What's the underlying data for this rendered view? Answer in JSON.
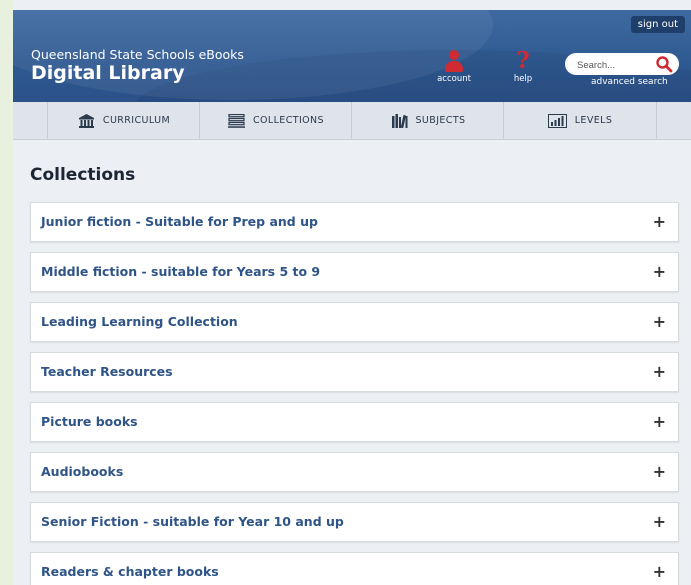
{
  "header": {
    "sign_out": "sign out",
    "subtitle": "Queensland State Schools eBooks",
    "title": "Digital Library",
    "account_label": "account",
    "help_label": "help",
    "search_placeholder": "Search...",
    "advanced_search": "advanced search",
    "accent_color": "#cf2b33"
  },
  "nav": {
    "items": [
      {
        "label": "CURRICULUM",
        "icon": "building-icon"
      },
      {
        "label": "COLLECTIONS",
        "icon": "list-icon"
      },
      {
        "label": "SUBJECTS",
        "icon": "books-icon"
      },
      {
        "label": "LEVELS",
        "icon": "bar-chart-icon"
      }
    ]
  },
  "main": {
    "heading": "Collections",
    "collections": [
      {
        "label": "Junior fiction - Suitable for Prep and up",
        "toggle": "+"
      },
      {
        "label": "Middle fiction - suitable for Years 5 to 9",
        "toggle": "+"
      },
      {
        "label": "Leading Learning Collection",
        "toggle": "+"
      },
      {
        "label": "Teacher Resources",
        "toggle": "+"
      },
      {
        "label": "Picture books",
        "toggle": "+"
      },
      {
        "label": "Audiobooks",
        "toggle": "+"
      },
      {
        "label": "Senior Fiction - suitable for Year 10 and up",
        "toggle": "+"
      },
      {
        "label": "Readers & chapter books",
        "toggle": "+"
      }
    ]
  }
}
